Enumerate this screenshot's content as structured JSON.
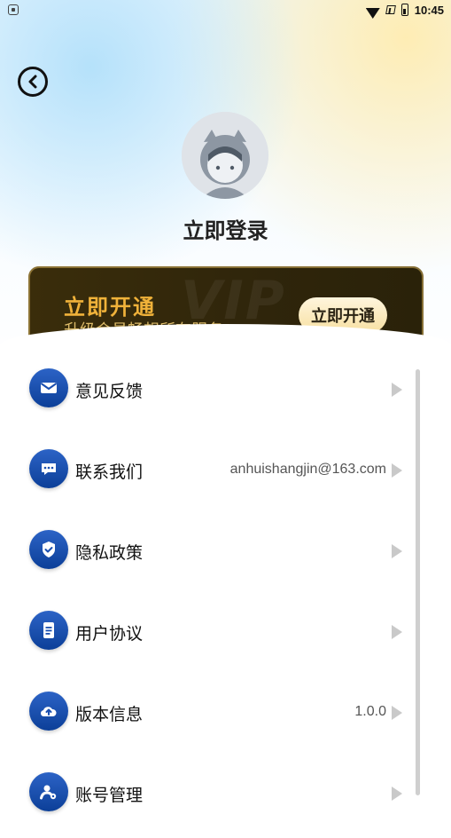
{
  "status_bar": {
    "time": "10:45"
  },
  "header": {
    "login_title": "立即登录"
  },
  "vip_banner": {
    "title": "立即开通",
    "subtitle": "升级会员畅想所有服务",
    "button_label": "立即开通",
    "watermark": "VIP"
  },
  "menu": {
    "items": [
      {
        "label": "意见反馈",
        "value": "",
        "icon": "mail-icon"
      },
      {
        "label": "联系我们",
        "value": "anhuishangjin@163.com",
        "icon": "chat-icon"
      },
      {
        "label": "隐私政策",
        "value": "",
        "icon": "shield-icon"
      },
      {
        "label": "用户协议",
        "value": "",
        "icon": "document-icon"
      },
      {
        "label": "版本信息",
        "value": "1.0.0",
        "icon": "cloud-upload-icon"
      },
      {
        "label": "账号管理",
        "value": "",
        "icon": "user-settings-icon"
      }
    ]
  },
  "colors": {
    "accent_blue": "#1a4fb0",
    "vip_gold": "#f0b23a",
    "vip_bg": "#2f250b"
  }
}
